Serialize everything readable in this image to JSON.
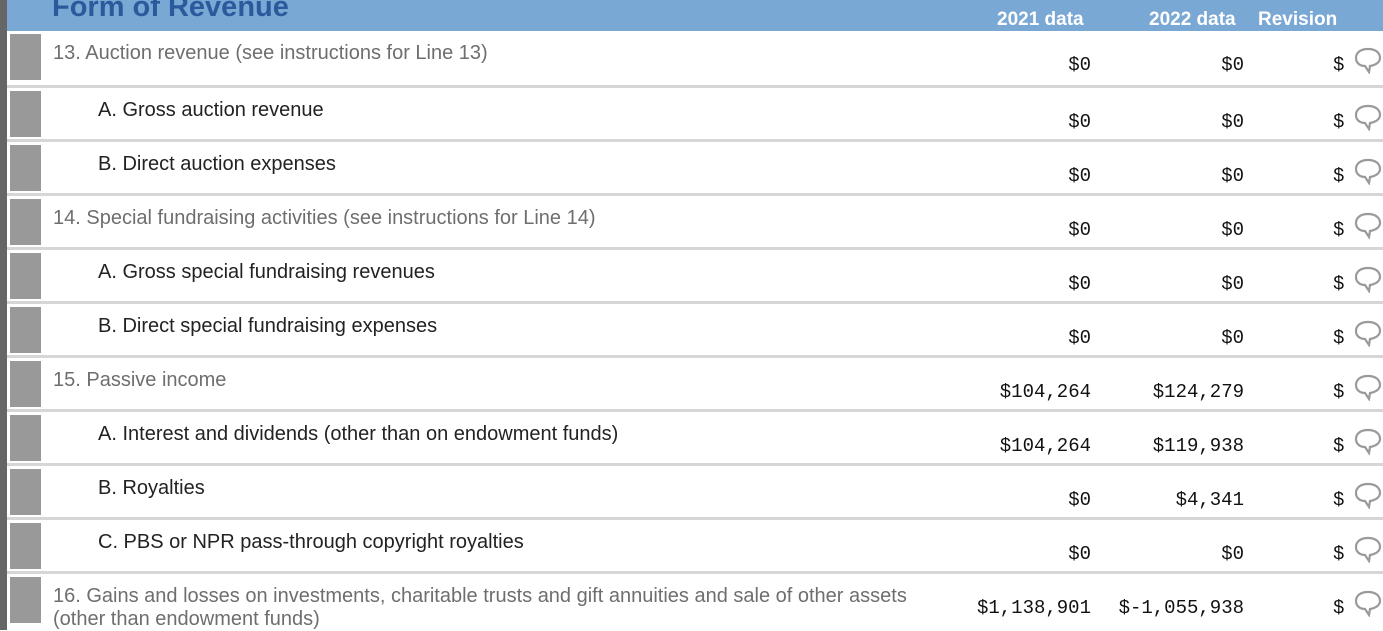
{
  "header": {
    "title": "Form of Revenue",
    "col_2021": "2021 data",
    "col_2022": "2022 data",
    "col_revision": "Revision"
  },
  "rows": [
    {
      "label": "13. Auction revenue (see instructions for Line 13)",
      "v2021": "$0",
      "v2022": "$0",
      "rev": "$"
    },
    {
      "label": "A. Gross auction revenue",
      "v2021": "$0",
      "v2022": "$0",
      "rev": "$"
    },
    {
      "label": "B. Direct auction expenses",
      "v2021": "$0",
      "v2022": "$0",
      "rev": "$"
    },
    {
      "label": "14. Special fundraising activities (see instructions for Line 14)",
      "v2021": "$0",
      "v2022": "$0",
      "rev": "$"
    },
    {
      "label": "A. Gross special fundraising revenues",
      "v2021": "$0",
      "v2022": "$0",
      "rev": "$"
    },
    {
      "label": "B. Direct special fundraising expenses",
      "v2021": "$0",
      "v2022": "$0",
      "rev": "$"
    },
    {
      "label": "15. Passive income",
      "v2021": "$104,264",
      "v2022": "$124,279",
      "rev": "$"
    },
    {
      "label": "A. Interest and dividends (other than on endowment funds)",
      "v2021": "$104,264",
      "v2022": "$119,938",
      "rev": "$"
    },
    {
      "label": "B. Royalties",
      "v2021": "$0",
      "v2022": "$4,341",
      "rev": "$"
    },
    {
      "label": "C. PBS or NPR pass-through copyright royalties",
      "v2021": "$0",
      "v2022": "$0",
      "rev": "$"
    },
    {
      "label": "16. Gains and losses on investments, charitable trusts and gift annuities and sale of other assets (other than endowment funds)",
      "v2021": "$1,138,901",
      "v2022": "$-1,055,938",
      "rev": "$"
    }
  ],
  "icons": {
    "comment": "comment-bubble-icon",
    "drag": "drag-handle"
  }
}
